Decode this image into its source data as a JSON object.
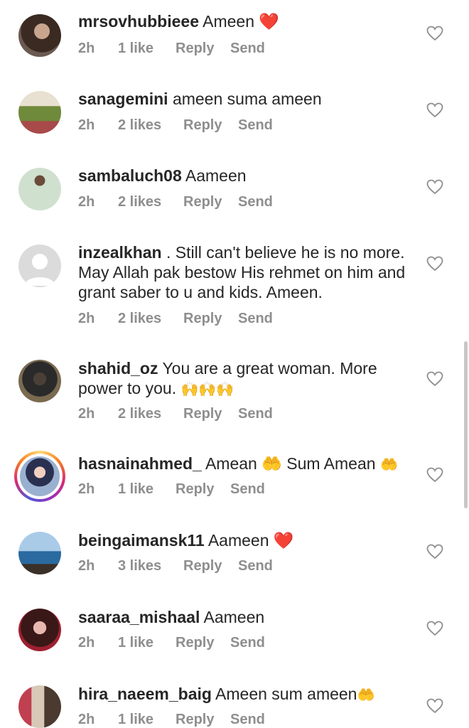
{
  "comments": [
    {
      "username": "mrsovhubbieee",
      "text": "Ameen",
      "emoji": "❤️",
      "time": "2h",
      "likes": "1 like",
      "reply": "Reply",
      "send": "Send"
    },
    {
      "username": "sanagemini",
      "text": "ameen suma ameen",
      "emoji": "",
      "time": "2h",
      "likes": "2 likes",
      "reply": "Reply",
      "send": "Send"
    },
    {
      "username": "sambaluch08",
      "text": "Aameen",
      "emoji": "",
      "time": "2h",
      "likes": "2 likes",
      "reply": "Reply",
      "send": "Send"
    },
    {
      "username": "inzealkhan",
      "text": ". Still can't believe he is no more. May Allah pak bestow His rehmet on him and grant saber to u and kids. Ameen.",
      "emoji": "",
      "time": "2h",
      "likes": "2 likes",
      "reply": "Reply",
      "send": "Send"
    },
    {
      "username": "shahid_oz",
      "text": "You are a great woman. More power to you.",
      "emoji": "🙌🙌🙌",
      "time": "2h",
      "likes": "2 likes",
      "reply": "Reply",
      "send": "Send"
    },
    {
      "username": "hasnainahmed_",
      "text": "Amean 🤲 Sum Amean",
      "emoji": "🤲",
      "time": "2h",
      "likes": "1 like",
      "reply": "Reply",
      "send": "Send"
    },
    {
      "username": "beingaimansk11",
      "text": "Aameen",
      "emoji": "❤️",
      "time": "2h",
      "likes": "3 likes",
      "reply": "Reply",
      "send": "Send"
    },
    {
      "username": "saaraa_mishaal",
      "text": "Aameen",
      "emoji": "",
      "time": "2h",
      "likes": "1 like",
      "reply": "Reply",
      "send": "Send"
    },
    {
      "username": "hira_naeem_baig",
      "text": "Ameen sum ameen",
      "emoji": "🤲",
      "time": "2h",
      "likes": "1 like",
      "reply": "Reply",
      "send": "Send"
    }
  ],
  "icons": {
    "like": "heart-outline-icon"
  },
  "colors": {
    "meta_gray": "#8e8e8e",
    "text": "#262626",
    "heart_red": "#e0245e"
  }
}
